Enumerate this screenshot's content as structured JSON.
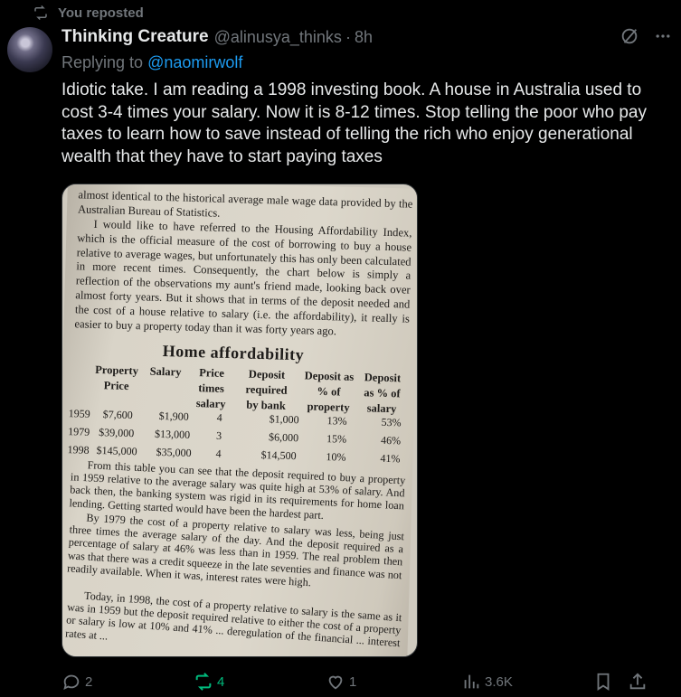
{
  "repost_banner": {
    "text": "You reposted"
  },
  "author": {
    "name": "Thinking Creature",
    "handle": "@alinusya_thinks",
    "separator": "·",
    "time": "8h"
  },
  "replying_to": {
    "prefix": "Replying to ",
    "mention": "@naomirwolf"
  },
  "tweet": {
    "text": "Idiotic take. I am reading a 1998 investing book. A house in Australia used to cost 3-4 times your salary. Now it is 8-12 times. Stop telling the poor who pay taxes to learn how to save instead of telling the rich who enjoy generational wealth that they have to start paying taxes"
  },
  "book_page": {
    "para0": "almost identical to the historical average male wage data provided by the Australian Bureau of Statistics.",
    "para1": "I would like to have referred to the Housing Affordability Index, which is the official measure of the cost of borrowing to buy a house relative to average wages, but unfortunately this has only been calculated in more recent times. Consequently, the chart below is simply a reflection of the observations my aunt's friend made, looking back over almost forty years. But it shows that in terms of the deposit needed and the cost of a house relative to salary (i.e. the affordability), it really is easier to buy a property today than it was forty years ago.",
    "title": "Home affordability",
    "headers": {
      "property_price": "Property Price",
      "salary": "Salary",
      "price_times_salary": "Price times salary",
      "deposit_required": "Deposit required by bank",
      "deposit_pct_property": "Deposit as % of property",
      "deposit_pct_salary": "Deposit as % of salary"
    },
    "rows": [
      {
        "year": "1959",
        "price": "$7,600",
        "salary": "$1,900",
        "times": "4",
        "deposit": "$1,000",
        "pct_property": "13%",
        "pct_salary": "53%"
      },
      {
        "year": "1979",
        "price": "$39,000",
        "salary": "$13,000",
        "times": "3",
        "deposit": "$6,000",
        "pct_property": "15%",
        "pct_salary": "46%"
      },
      {
        "year": "1998",
        "price": "$145,000",
        "salary": "$35,000",
        "times": "4",
        "deposit": "$14,500",
        "pct_property": "10%",
        "pct_salary": "41%"
      }
    ],
    "para2": "From this table you can see that the deposit required to buy a property in 1959 relative to the average salary was quite high at 53% of salary. And back then, the banking system was rigid in its requirements for home loan lending. Getting started would have been the hardest part.",
    "para3": "By 1979 the cost of a property relative to salary was less, being just three times the average salary of the day. And the deposit required as a percentage of salary at 46% was less than in 1959. The real problem then was that there was a credit squeeze in the late seventies and finance was not readily available. When it was, interest rates were high.",
    "para4": "Today, in 1998, the cost of a property relative to salary is the same as it was in 1959 but the deposit required relative to either the cost of a property or salary is low at 10% and 41% ... deregulation of the financial ... interest rates at ..."
  },
  "actions": {
    "replies": "2",
    "reposts": "4",
    "likes": "1",
    "views": "3.6K"
  },
  "colors": {
    "background": "#000000",
    "text": "#e7e9ea",
    "muted": "#71767b",
    "link": "#1d9bf0",
    "repost_active": "#00ba7c"
  }
}
